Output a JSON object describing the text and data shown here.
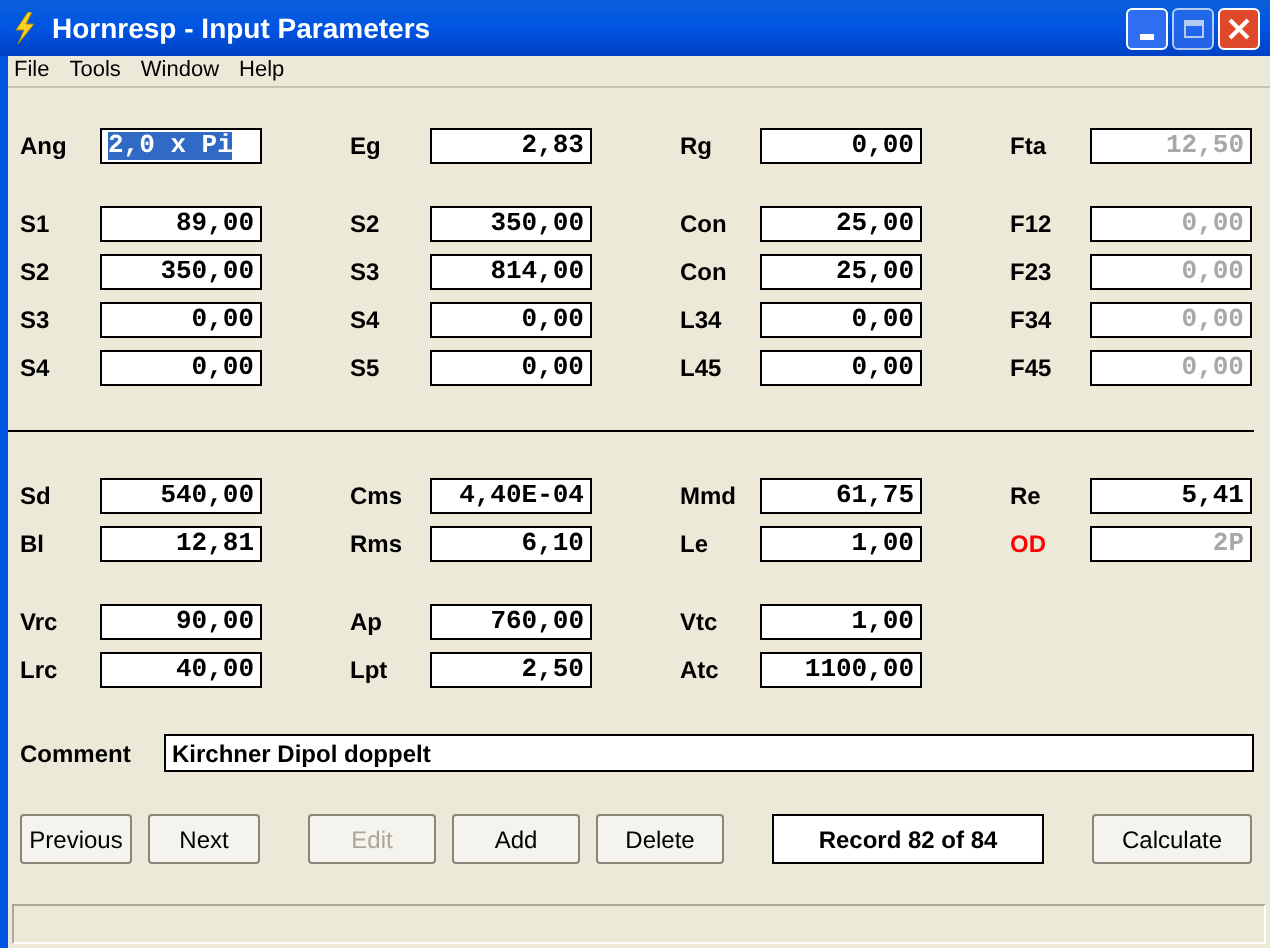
{
  "window": {
    "title": "Hornresp - Input Parameters"
  },
  "menu": [
    "File",
    "Tools",
    "Window",
    "Help"
  ],
  "sections": [
    {
      "groups": [
        {
          "rows": [
            {
              "cells": [
                {
                  "label": "Ang",
                  "value": "2,0 x Pi",
                  "selected": true,
                  "disabled": false
                },
                {
                  "label": "Eg",
                  "value": "2,83",
                  "selected": false,
                  "disabled": false
                },
                {
                  "label": "Rg",
                  "value": "0,00",
                  "selected": false,
                  "disabled": false
                },
                {
                  "label": "Fta",
                  "value": "12,50",
                  "selected": false,
                  "disabled": true
                }
              ]
            }
          ]
        },
        {
          "rows": [
            {
              "cells": [
                {
                  "label": "S1",
                  "value": "89,00",
                  "selected": false,
                  "disabled": false
                },
                {
                  "label": "S2",
                  "value": "350,00",
                  "selected": false,
                  "disabled": false
                },
                {
                  "label": "Con",
                  "value": "25,00",
                  "selected": false,
                  "disabled": false
                },
                {
                  "label": "F12",
                  "value": "0,00",
                  "selected": false,
                  "disabled": true
                }
              ]
            },
            {
              "cells": [
                {
                  "label": "S2",
                  "value": "350,00",
                  "selected": false,
                  "disabled": false
                },
                {
                  "label": "S3",
                  "value": "814,00",
                  "selected": false,
                  "disabled": false
                },
                {
                  "label": "Con",
                  "value": "25,00",
                  "selected": false,
                  "disabled": false
                },
                {
                  "label": "F23",
                  "value": "0,00",
                  "selected": false,
                  "disabled": true
                }
              ]
            },
            {
              "cells": [
                {
                  "label": "S3",
                  "value": "0,00",
                  "selected": false,
                  "disabled": false
                },
                {
                  "label": "S4",
                  "value": "0,00",
                  "selected": false,
                  "disabled": false
                },
                {
                  "label": "L34",
                  "value": "0,00",
                  "selected": false,
                  "disabled": false
                },
                {
                  "label": "F34",
                  "value": "0,00",
                  "selected": false,
                  "disabled": true
                }
              ]
            },
            {
              "cells": [
                {
                  "label": "S4",
                  "value": "0,00",
                  "selected": false,
                  "disabled": false
                },
                {
                  "label": "S5",
                  "value": "0,00",
                  "selected": false,
                  "disabled": false
                },
                {
                  "label": "L45",
                  "value": "0,00",
                  "selected": false,
                  "disabled": false
                },
                {
                  "label": "F45",
                  "value": "0,00",
                  "selected": false,
                  "disabled": true
                }
              ]
            }
          ]
        }
      ]
    },
    {
      "groups": [
        {
          "rows": [
            {
              "cells": [
                {
                  "label": "Sd",
                  "value": "540,00",
                  "selected": false,
                  "disabled": false
                },
                {
                  "label": "Cms",
                  "value": "4,40E-04",
                  "selected": false,
                  "disabled": false
                },
                {
                  "label": "Mmd",
                  "value": "61,75",
                  "selected": false,
                  "disabled": false
                },
                {
                  "label": "Re",
                  "value": "5,41",
                  "selected": false,
                  "disabled": false
                }
              ]
            },
            {
              "cells": [
                {
                  "label": "Bl",
                  "value": "12,81",
                  "selected": false,
                  "disabled": false
                },
                {
                  "label": "Rms",
                  "value": "6,10",
                  "selected": false,
                  "disabled": false
                },
                {
                  "label": "Le",
                  "value": "1,00",
                  "selected": false,
                  "disabled": false
                },
                {
                  "label": "OD",
                  "value": "2P",
                  "selected": false,
                  "disabled": true,
                  "color": "#ff0000"
                }
              ]
            }
          ]
        },
        {
          "rows": [
            {
              "cells": [
                {
                  "label": "Vrc",
                  "value": "90,00",
                  "selected": false,
                  "disabled": false
                },
                {
                  "label": "Ap",
                  "value": "760,00",
                  "selected": false,
                  "disabled": false
                },
                {
                  "label": "Vtc",
                  "value": "1,00",
                  "selected": false,
                  "disabled": false
                }
              ]
            },
            {
              "cells": [
                {
                  "label": "Lrc",
                  "value": "40,00",
                  "selected": false,
                  "disabled": false
                },
                {
                  "label": "Lpt",
                  "value": "2,50",
                  "selected": false,
                  "disabled": false
                },
                {
                  "label": "Atc",
                  "value": "1100,00",
                  "selected": false,
                  "disabled": false
                }
              ]
            }
          ]
        }
      ]
    }
  ],
  "comment": {
    "label": "Comment",
    "value": "Kirchner Dipol doppelt"
  },
  "buttons": [
    {
      "label": "Previous",
      "kind": "button",
      "disabled": false
    },
    {
      "label": "Next",
      "kind": "button",
      "disabled": false
    },
    {
      "label": "Edit",
      "kind": "button",
      "disabled": true
    },
    {
      "label": "Add",
      "kind": "button",
      "disabled": false
    },
    {
      "label": "Delete",
      "kind": "button",
      "disabled": false
    },
    {
      "label": "Record 82 of 84",
      "kind": "readout",
      "disabled": false
    },
    {
      "label": "Calculate",
      "kind": "button",
      "disabled": false
    }
  ]
}
